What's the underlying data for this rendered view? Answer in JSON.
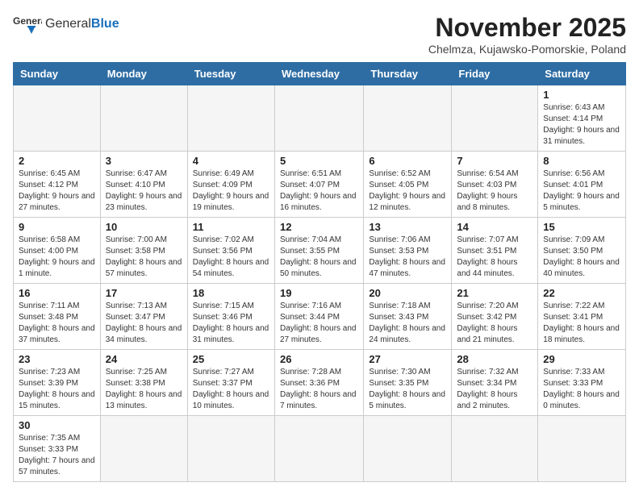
{
  "header": {
    "logo_text_normal": "General",
    "logo_text_bold": "Blue",
    "title": "November 2025",
    "subtitle": "Chelmza, Kujawsko-Pomorskie, Poland"
  },
  "weekdays": [
    "Sunday",
    "Monday",
    "Tuesday",
    "Wednesday",
    "Thursday",
    "Friday",
    "Saturday"
  ],
  "weeks": [
    [
      {
        "day": "",
        "info": ""
      },
      {
        "day": "",
        "info": ""
      },
      {
        "day": "",
        "info": ""
      },
      {
        "day": "",
        "info": ""
      },
      {
        "day": "",
        "info": ""
      },
      {
        "day": "",
        "info": ""
      },
      {
        "day": "1",
        "info": "Sunrise: 6:43 AM\nSunset: 4:14 PM\nDaylight: 9 hours and 31 minutes."
      }
    ],
    [
      {
        "day": "2",
        "info": "Sunrise: 6:45 AM\nSunset: 4:12 PM\nDaylight: 9 hours and 27 minutes."
      },
      {
        "day": "3",
        "info": "Sunrise: 6:47 AM\nSunset: 4:10 PM\nDaylight: 9 hours and 23 minutes."
      },
      {
        "day": "4",
        "info": "Sunrise: 6:49 AM\nSunset: 4:09 PM\nDaylight: 9 hours and 19 minutes."
      },
      {
        "day": "5",
        "info": "Sunrise: 6:51 AM\nSunset: 4:07 PM\nDaylight: 9 hours and 16 minutes."
      },
      {
        "day": "6",
        "info": "Sunrise: 6:52 AM\nSunset: 4:05 PM\nDaylight: 9 hours and 12 minutes."
      },
      {
        "day": "7",
        "info": "Sunrise: 6:54 AM\nSunset: 4:03 PM\nDaylight: 9 hours and 8 minutes."
      },
      {
        "day": "8",
        "info": "Sunrise: 6:56 AM\nSunset: 4:01 PM\nDaylight: 9 hours and 5 minutes."
      }
    ],
    [
      {
        "day": "9",
        "info": "Sunrise: 6:58 AM\nSunset: 4:00 PM\nDaylight: 9 hours and 1 minute."
      },
      {
        "day": "10",
        "info": "Sunrise: 7:00 AM\nSunset: 3:58 PM\nDaylight: 8 hours and 57 minutes."
      },
      {
        "day": "11",
        "info": "Sunrise: 7:02 AM\nSunset: 3:56 PM\nDaylight: 8 hours and 54 minutes."
      },
      {
        "day": "12",
        "info": "Sunrise: 7:04 AM\nSunset: 3:55 PM\nDaylight: 8 hours and 50 minutes."
      },
      {
        "day": "13",
        "info": "Sunrise: 7:06 AM\nSunset: 3:53 PM\nDaylight: 8 hours and 47 minutes."
      },
      {
        "day": "14",
        "info": "Sunrise: 7:07 AM\nSunset: 3:51 PM\nDaylight: 8 hours and 44 minutes."
      },
      {
        "day": "15",
        "info": "Sunrise: 7:09 AM\nSunset: 3:50 PM\nDaylight: 8 hours and 40 minutes."
      }
    ],
    [
      {
        "day": "16",
        "info": "Sunrise: 7:11 AM\nSunset: 3:48 PM\nDaylight: 8 hours and 37 minutes."
      },
      {
        "day": "17",
        "info": "Sunrise: 7:13 AM\nSunset: 3:47 PM\nDaylight: 8 hours and 34 minutes."
      },
      {
        "day": "18",
        "info": "Sunrise: 7:15 AM\nSunset: 3:46 PM\nDaylight: 8 hours and 31 minutes."
      },
      {
        "day": "19",
        "info": "Sunrise: 7:16 AM\nSunset: 3:44 PM\nDaylight: 8 hours and 27 minutes."
      },
      {
        "day": "20",
        "info": "Sunrise: 7:18 AM\nSunset: 3:43 PM\nDaylight: 8 hours and 24 minutes."
      },
      {
        "day": "21",
        "info": "Sunrise: 7:20 AM\nSunset: 3:42 PM\nDaylight: 8 hours and 21 minutes."
      },
      {
        "day": "22",
        "info": "Sunrise: 7:22 AM\nSunset: 3:41 PM\nDaylight: 8 hours and 18 minutes."
      }
    ],
    [
      {
        "day": "23",
        "info": "Sunrise: 7:23 AM\nSunset: 3:39 PM\nDaylight: 8 hours and 15 minutes."
      },
      {
        "day": "24",
        "info": "Sunrise: 7:25 AM\nSunset: 3:38 PM\nDaylight: 8 hours and 13 minutes."
      },
      {
        "day": "25",
        "info": "Sunrise: 7:27 AM\nSunset: 3:37 PM\nDaylight: 8 hours and 10 minutes."
      },
      {
        "day": "26",
        "info": "Sunrise: 7:28 AM\nSunset: 3:36 PM\nDaylight: 8 hours and 7 minutes."
      },
      {
        "day": "27",
        "info": "Sunrise: 7:30 AM\nSunset: 3:35 PM\nDaylight: 8 hours and 5 minutes."
      },
      {
        "day": "28",
        "info": "Sunrise: 7:32 AM\nSunset: 3:34 PM\nDaylight: 8 hours and 2 minutes."
      },
      {
        "day": "29",
        "info": "Sunrise: 7:33 AM\nSunset: 3:33 PM\nDaylight: 8 hours and 0 minutes."
      }
    ],
    [
      {
        "day": "30",
        "info": "Sunrise: 7:35 AM\nSunset: 3:33 PM\nDaylight: 7 hours and 57 minutes."
      },
      {
        "day": "",
        "info": ""
      },
      {
        "day": "",
        "info": ""
      },
      {
        "day": "",
        "info": ""
      },
      {
        "day": "",
        "info": ""
      },
      {
        "day": "",
        "info": ""
      },
      {
        "day": "",
        "info": ""
      }
    ]
  ]
}
